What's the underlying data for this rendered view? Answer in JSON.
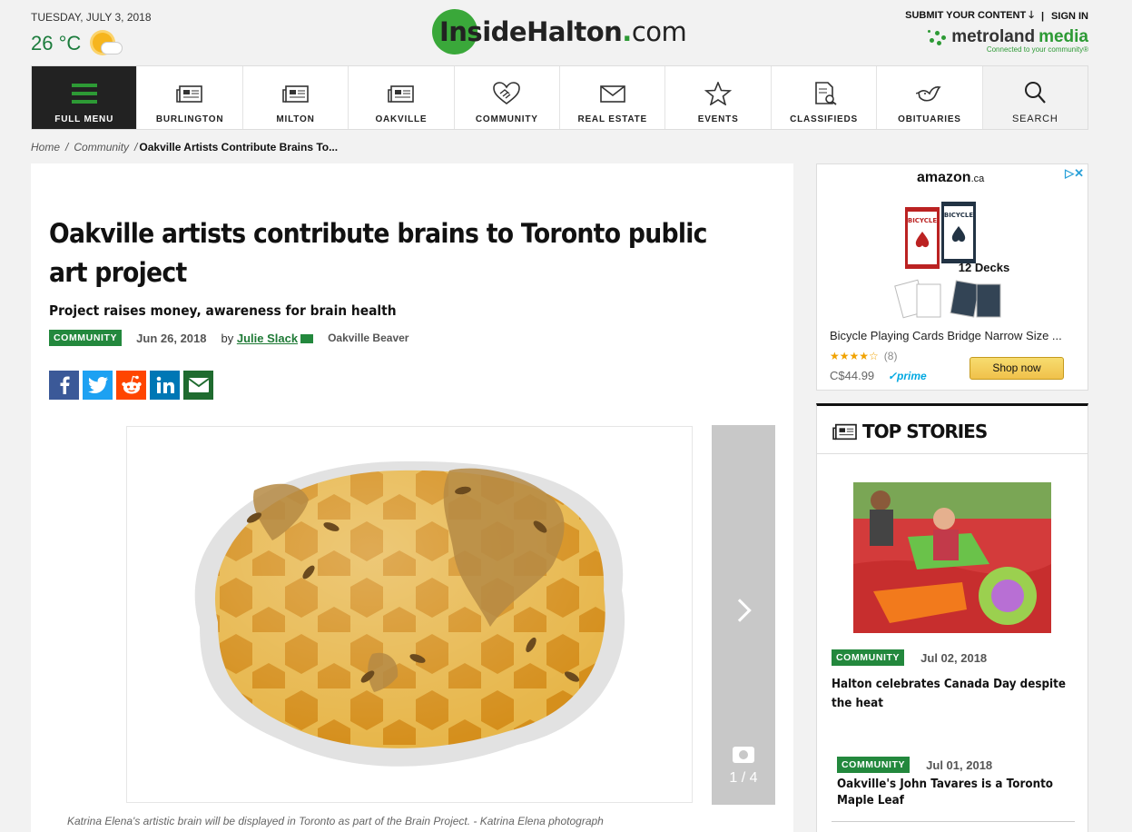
{
  "header": {
    "date": "TUESDAY, JULY 3, 2018",
    "temperature": "26 °C",
    "weather_icon": "sun-cloud-icon",
    "logo_main": "InsideHalton",
    "logo_dot": ".",
    "logo_com": "com",
    "submit_link": "SUBMIT YOUR CONTENT",
    "sign_in_link": "SIGN IN",
    "metroland_part1": "metroland",
    "metroland_part2": "media",
    "metroland_tagline": "Connected to your community®"
  },
  "nav": {
    "items": [
      {
        "label": "FULL MENU",
        "icon": "hamburger-icon"
      },
      {
        "label": "BURLINGTON",
        "icon": "newspaper-icon"
      },
      {
        "label": "MILTON",
        "icon": "newspaper-icon"
      },
      {
        "label": "OAKVILLE",
        "icon": "newspaper-icon"
      },
      {
        "label": "COMMUNITY",
        "icon": "handshake-heart-icon"
      },
      {
        "label": "REAL ESTATE",
        "icon": "envelope-icon"
      },
      {
        "label": "EVENTS",
        "icon": "star-icon"
      },
      {
        "label": "CLASSIFIEDS",
        "icon": "document-search-icon"
      },
      {
        "label": "OBITUARIES",
        "icon": "dove-icon"
      },
      {
        "label": "SEARCH",
        "icon": "magnifier-icon"
      }
    ]
  },
  "breadcrumb": {
    "home": "Home",
    "sep1": "/",
    "section": "Community",
    "sep2": "/",
    "current": "Oakville Artists Contribute Brains To..."
  },
  "article": {
    "headline": "Oakville artists contribute brains to Toronto public art project",
    "subhead": "Project raises money, awareness for brain health",
    "category": "COMMUNITY",
    "date": "Jun 26, 2018",
    "by": "by",
    "author": "Julie Slack",
    "publication": "Oakville Beaver",
    "share": [
      {
        "label": "f",
        "icon": "facebook-icon",
        "color": "#3b5998"
      },
      {
        "label": "t",
        "icon": "twitter-icon",
        "color": "#1da1f2"
      },
      {
        "label": "r",
        "icon": "reddit-icon",
        "color": "#ff4500"
      },
      {
        "label": "in",
        "icon": "linkedin-icon",
        "color": "#0077b5"
      },
      {
        "label": "✉",
        "icon": "email-icon",
        "color": "#1f6b2f"
      }
    ],
    "gallery_count": "1 / 4",
    "caption": "Katrina Elena's artistic brain will be displayed in Toronto as part of the Brain Project. - Katrina Elena photograph"
  },
  "ad": {
    "brand": "amazon",
    "brand_suffix": ".ca",
    "product_box_label": "12 Decks",
    "product_brand_label": "BICYCLE",
    "title": "Bicycle Playing Cards Bridge Narrow Size ...",
    "stars": "★★★★☆",
    "reviews": "(8)",
    "price": "C$44.99",
    "prime": "✓prime",
    "shop_label": "Shop now",
    "adchoices": "▷✕"
  },
  "top_stories": {
    "heading": "TOP STORIES",
    "items": [
      {
        "category": "COMMUNITY",
        "date": "Jul 02, 2018",
        "title": "Halton celebrates Canada Day despite the heat"
      },
      {
        "category": "COMMUNITY",
        "date": "Jul 01, 2018",
        "title": "Oakville's John Tavares is a Toronto Maple Leaf"
      }
    ]
  },
  "colors": {
    "brand_green": "#23883d",
    "nav_dark": "#222222",
    "honey": "#e0a530"
  }
}
